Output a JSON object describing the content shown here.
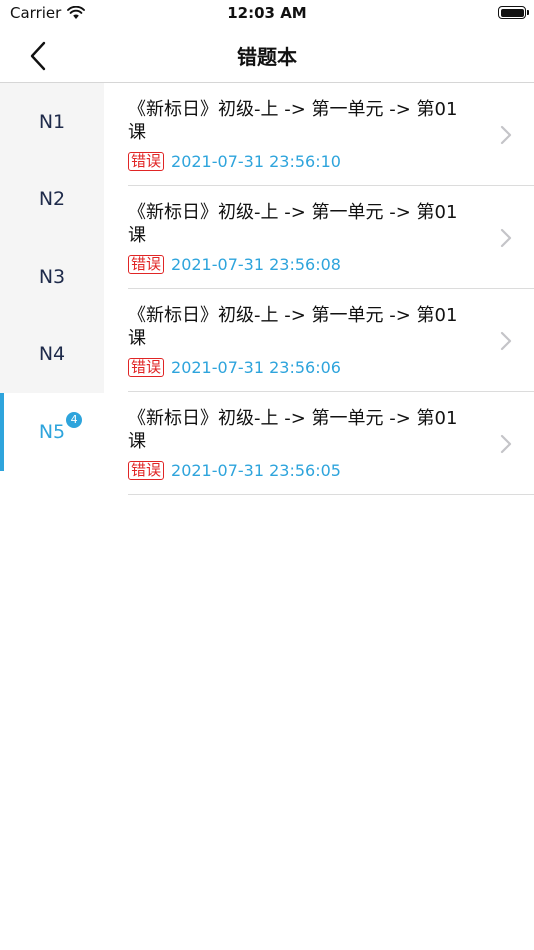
{
  "status_bar": {
    "carrier": "Carrier",
    "time": "12:03 AM",
    "wifi_icon": "wifi-icon",
    "battery_icon": "battery-icon"
  },
  "nav": {
    "title": "错题本",
    "back_icon": "chevron-left-icon"
  },
  "levels": {
    "items": [
      {
        "label": "N1"
      },
      {
        "label": "N2"
      },
      {
        "label": "N3"
      },
      {
        "label": "N4"
      },
      {
        "label": "N5",
        "badge": "4",
        "active": true
      }
    ]
  },
  "records": {
    "items": [
      {
        "title": "《新标日》初级-上 -> 第一单元 -> 第01课",
        "tag": "错误",
        "time": "2021-07-31 23:56:10"
      },
      {
        "title": "《新标日》初级-上 -> 第一单元 -> 第01课",
        "tag": "错误",
        "time": "2021-07-31 23:56:08"
      },
      {
        "title": "《新标日》初级-上 -> 第一单元 -> 第01课",
        "tag": "错误",
        "time": "2021-07-31 23:56:06"
      },
      {
        "title": "《新标日》初级-上 -> 第一单元 -> 第01课",
        "tag": "错误",
        "time": "2021-07-31 23:56:05"
      }
    ]
  },
  "colors": {
    "accent": "#2ea4dc",
    "error": "#e02525",
    "sidebar_bg": "#f5f5f5"
  }
}
